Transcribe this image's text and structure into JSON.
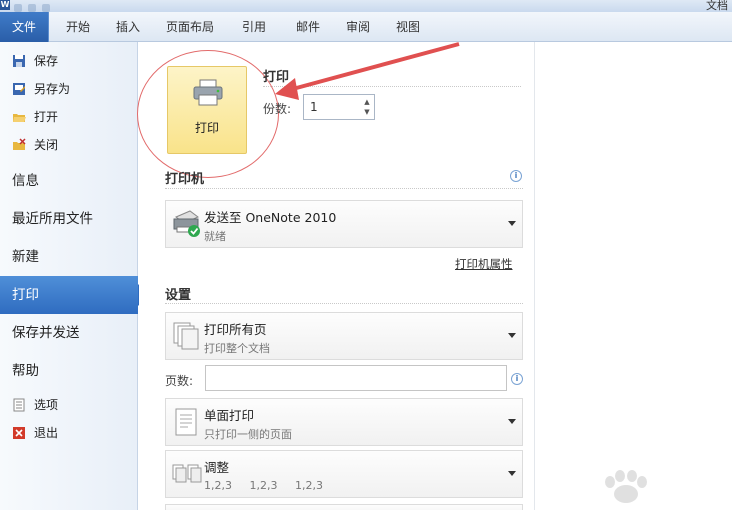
{
  "titlebar": {
    "doc_fragment": "文档"
  },
  "tabs": [
    {
      "label": "文件"
    },
    {
      "label": "开始"
    },
    {
      "label": "插入"
    },
    {
      "label": "页面布局"
    },
    {
      "label": "引用"
    },
    {
      "label": "邮件"
    },
    {
      "label": "审阅"
    },
    {
      "label": "视图"
    }
  ],
  "nav": {
    "save": "保存",
    "save_as": "另存为",
    "open": "打开",
    "close": "关闭",
    "info": "信息",
    "recent": "最近所用文件",
    "new": "新建",
    "print": "打印",
    "save_send": "保存并发送",
    "help": "帮助",
    "options": "选项",
    "exit": "退出"
  },
  "print_panel": {
    "print_button_label": "打印",
    "header": "打印",
    "copies_label": "份数:",
    "copies_value": "1"
  },
  "printer": {
    "section_title": "打印机",
    "name": "发送至 OneNote 2010",
    "status": "就绪",
    "properties_link": "打印机属性"
  },
  "settings": {
    "section_title": "设置",
    "range_title": "打印所有页",
    "range_sub": "打印整个文档",
    "pages_label": "页数:",
    "pages_value": "",
    "sides_title": "单面打印",
    "sides_sub": "只打印一侧的页面",
    "collate_title": "调整",
    "collate_sub": "1,2,3    1,2,3    1,2,3"
  },
  "colors": {
    "accent": "#2f6cc0",
    "highlight": "#f9e38a",
    "annotation": "#e05050"
  }
}
